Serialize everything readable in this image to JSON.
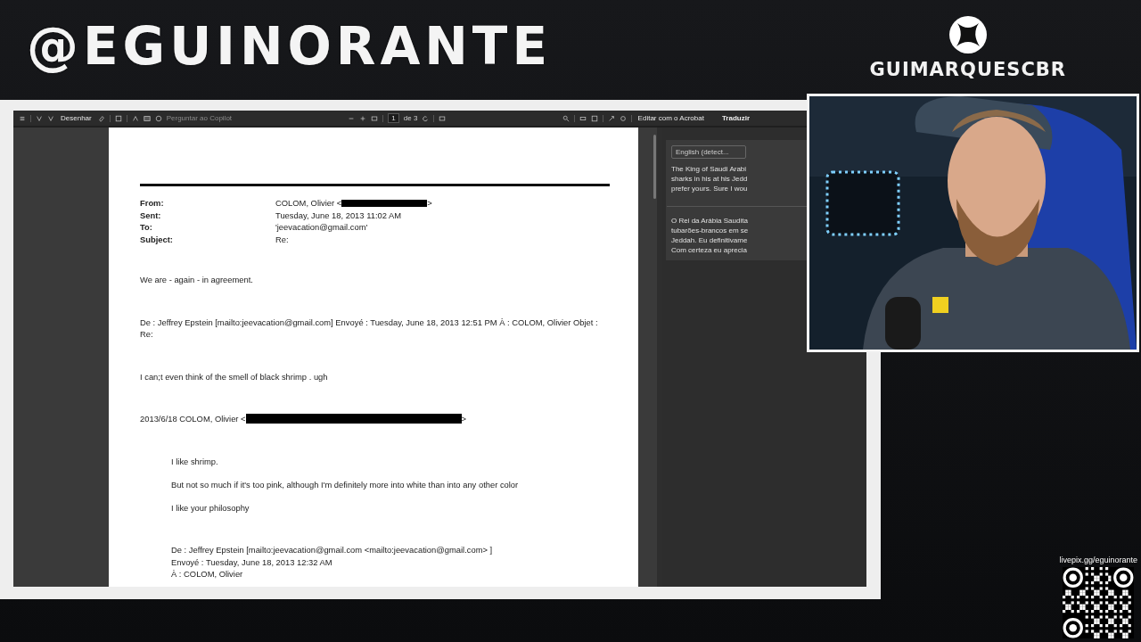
{
  "overlay": {
    "channel_name": "@EGUINORANTE",
    "gamertag": "GUIMARQUESCBR",
    "donation_link": "livepix.gg/eguinorante"
  },
  "toolbar": {
    "draw_label": "Desenhar",
    "copilot_placeholder": "Perguntar ao Copilot",
    "page_number": "1",
    "page_count": "de 3",
    "acrobat_button": "Editar com o Acrobat"
  },
  "translate_panel": {
    "title": "Traduzir",
    "language": "English (detect...",
    "source_lines": [
      "The King of Saudi Arabi",
      "sharks in his at his Jedd",
      "prefer yours. Sure I wou"
    ],
    "translated_lines": [
      "O Rei da Arábia Saudita",
      "tubarões-brancos em se",
      "Jeddah. Eu definitivame",
      "Com certeza eu aprecia"
    ]
  },
  "document": {
    "header_fields": [
      {
        "label": "From:",
        "value": "COLOM, Olivier <",
        "redacted": true,
        "after": ">"
      },
      {
        "label": "Sent:",
        "value": "Tuesday, June 18, 2013 11:02 AM",
        "redacted": false
      },
      {
        "label": "To:",
        "value": "'jeevacation@gmail.com'",
        "redacted": false
      },
      {
        "label": "Subject:",
        "value": "Re:",
        "redacted": false
      }
    ],
    "blocks": [
      {
        "indented": false,
        "spaced": false,
        "lines": [
          {
            "text": "We are - again - in agreement.",
            "redacted": false
          }
        ]
      },
      {
        "indented": false,
        "spaced": false,
        "lines": [
          {
            "text": "De : Jeffrey Epstein [mailto:jeevacation@gmail.com] Envoyé : Tuesday, June 18, 2013 12:51 PM À : COLOM, Olivier Objet : Re:",
            "redacted": false
          }
        ]
      },
      {
        "indented": false,
        "spaced": false,
        "lines": [
          {
            "text": "I can;t even think of the smell  of black shrimp  . ugh",
            "redacted": false
          }
        ]
      },
      {
        "indented": false,
        "spaced": false,
        "lines": [
          {
            "text": "2013/6/18 COLOM, Olivier <",
            "redacted": true,
            "after": ">"
          }
        ]
      },
      {
        "indented": true,
        "spaced": true,
        "lines": [
          {
            "text": "I like shrimp.",
            "redacted": false
          },
          {
            "text": "But not so much if it's too pink, although I'm definitely more into white than into any other color",
            "redacted": false
          },
          {
            "text": "I like your philosophy",
            "redacted": false
          }
        ]
      },
      {
        "indented": true,
        "spaced": false,
        "lines": [
          {
            "text": "De : Jeffrey Epstein [mailto:jeevacation@gmail.com <mailto:jeevacation@gmail.com> ]",
            "redacted": false
          },
          {
            "text": "Envoyé : Tuesday, June 18, 2013 12:32 AM",
            "redacted": false
          },
          {
            "text": "À : COLOM, Olivier",
            "redacted": false
          }
        ]
      }
    ]
  }
}
